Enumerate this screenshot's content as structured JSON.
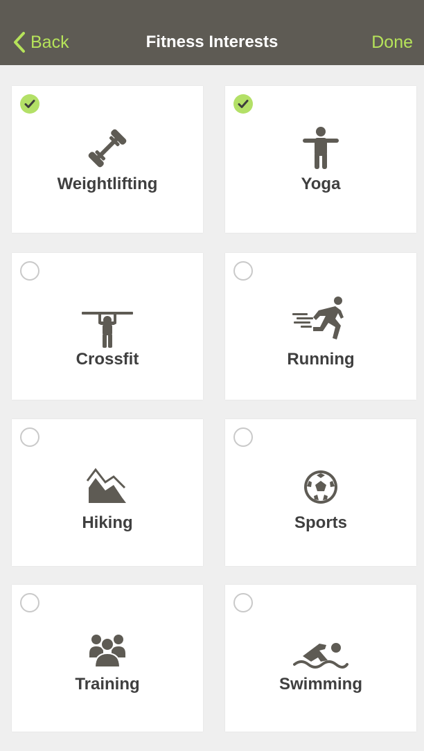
{
  "nav": {
    "back_label": "Back",
    "title": "Fitness Interests",
    "done_label": "Done"
  },
  "colors": {
    "nav_bg": "#5e5b54",
    "accent": "#b6e35a",
    "check_on": "#b3e067",
    "icon": "#5e5b54"
  },
  "interests": [
    {
      "label": "Weightlifting",
      "icon": "dumbbell-icon",
      "selected": true
    },
    {
      "label": "Yoga",
      "icon": "yoga-icon",
      "selected": true
    },
    {
      "label": "Crossfit",
      "icon": "pullup-icon",
      "selected": false
    },
    {
      "label": "Running",
      "icon": "runner-icon",
      "selected": false
    },
    {
      "label": "Hiking",
      "icon": "mountain-icon",
      "selected": false
    },
    {
      "label": "Sports",
      "icon": "soccer-ball-icon",
      "selected": false
    },
    {
      "label": "Training",
      "icon": "group-icon",
      "selected": false
    },
    {
      "label": "Swimming",
      "icon": "swimmer-icon",
      "selected": false
    }
  ]
}
